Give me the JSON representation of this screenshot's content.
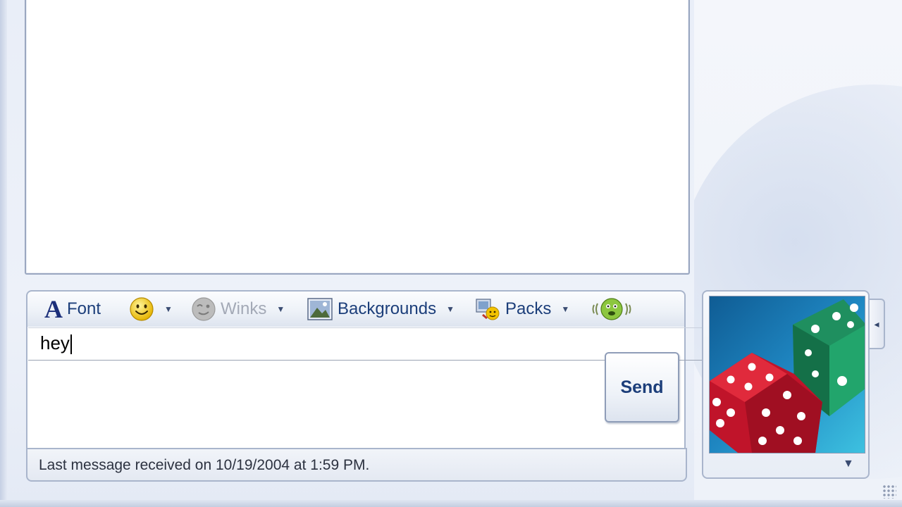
{
  "toolbar": {
    "font_label": "Font",
    "winks_label": "Winks",
    "backgrounds_label": "Backgrounds",
    "packs_label": "Packs"
  },
  "compose": {
    "text": "hey"
  },
  "send_label": "Send",
  "status": {
    "text": "Last message received on 10/19/2004 at 1:59 PM."
  },
  "icons": {
    "font": "font-icon",
    "emoticon": "smiley-icon",
    "winks": "wink-icon",
    "backgrounds": "backgrounds-icon",
    "packs": "packs-icon",
    "nudge": "nudge-icon",
    "display_picture": "dice-picture"
  },
  "colors": {
    "accent_text": "#1c3e7a",
    "disabled_text": "#a3a9b6"
  }
}
